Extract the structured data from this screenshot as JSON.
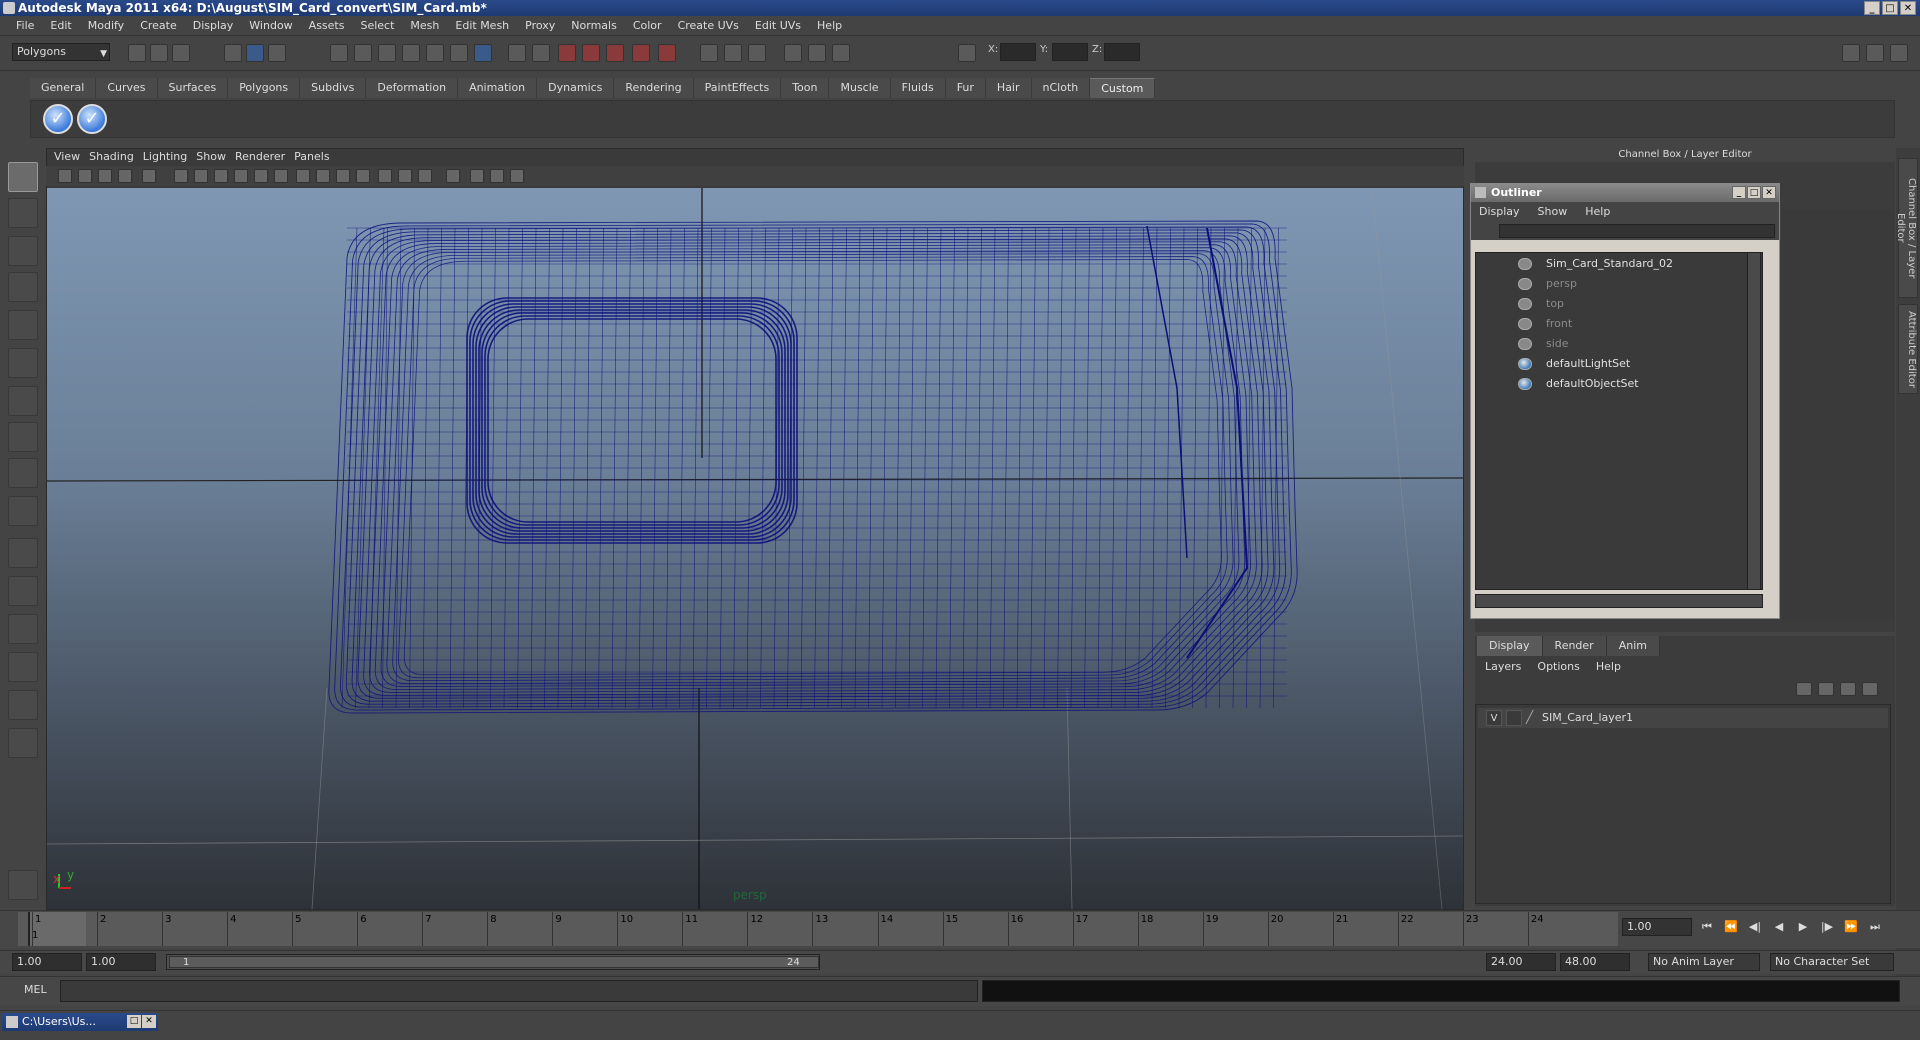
{
  "window": {
    "title": "Autodesk Maya 2011 x64: D:\\August\\SIM_Card_convert\\SIM_Card.mb*",
    "min": "_",
    "max": "□",
    "close": "✕"
  },
  "menubar": [
    "File",
    "Edit",
    "Modify",
    "Create",
    "Display",
    "Window",
    "Assets",
    "Select",
    "Mesh",
    "Edit Mesh",
    "Proxy",
    "Normals",
    "Color",
    "Create UVs",
    "Edit UVs",
    "Help"
  ],
  "statusline": {
    "mode": "Polygons",
    "x_label": "X:",
    "y_label": "Y:",
    "z_label": "Z:"
  },
  "shelf": {
    "tabs": [
      "General",
      "Curves",
      "Surfaces",
      "Polygons",
      "Subdivs",
      "Deformation",
      "Animation",
      "Dynamics",
      "Rendering",
      "PaintEffects",
      "Toon",
      "Muscle",
      "Fluids",
      "Fur",
      "Hair",
      "nCloth",
      "Custom"
    ],
    "active_tab": "Custom",
    "buttons": [
      "✓",
      "✓"
    ]
  },
  "viewport": {
    "menus": [
      "View",
      "Shading",
      "Lighting",
      "Show",
      "Renderer",
      "Panels"
    ],
    "camera_label": "persp",
    "axis_y": "y",
    "axis_x": "x"
  },
  "channel_box": {
    "title": "Channel Box / Layer Editor"
  },
  "side_tabs": [
    "Channel Box / Layer Editor",
    "Attribute Editor"
  ],
  "outliner": {
    "title": "Outliner",
    "menus": [
      "Display",
      "Show",
      "Help"
    ],
    "items": [
      {
        "label": "Sim_Card_Standard_02",
        "kind": "main"
      },
      {
        "label": "persp",
        "kind": "dim"
      },
      {
        "label": "top",
        "kind": "dim"
      },
      {
        "label": "front",
        "kind": "dim"
      },
      {
        "label": "side",
        "kind": "dim"
      },
      {
        "label": "defaultLightSet",
        "kind": "set"
      },
      {
        "label": "defaultObjectSet",
        "kind": "set"
      }
    ]
  },
  "layer_editor": {
    "tabs": [
      "Display",
      "Render",
      "Anim"
    ],
    "active_tab": "Display",
    "menus": [
      "Layers",
      "Options",
      "Help"
    ],
    "layer": {
      "visible": "V",
      "name": "SIM_Card_layer1"
    }
  },
  "timeslider": {
    "ticks": [
      "1",
      "2",
      "3",
      "4",
      "5",
      "6",
      "7",
      "8",
      "9",
      "10",
      "11",
      "12",
      "13",
      "14",
      "15",
      "16",
      "17",
      "18",
      "19",
      "20",
      "21",
      "22",
      "23",
      "24"
    ],
    "current_frame_marker": "1",
    "current_frame": "1.00"
  },
  "range": {
    "start": "1.00",
    "playback_start": "1.00",
    "slider_start": "1",
    "slider_end": "24",
    "playback_end": "24.00",
    "end": "48.00",
    "anim_layer": "No Anim Layer",
    "character_set": "No Character Set"
  },
  "cmdline": {
    "label": "MEL"
  },
  "taskbar": {
    "item": "C:\\Users\\Us..."
  },
  "colors": {
    "wire": "#0c0f7a",
    "accent": "#2a4a8a"
  }
}
